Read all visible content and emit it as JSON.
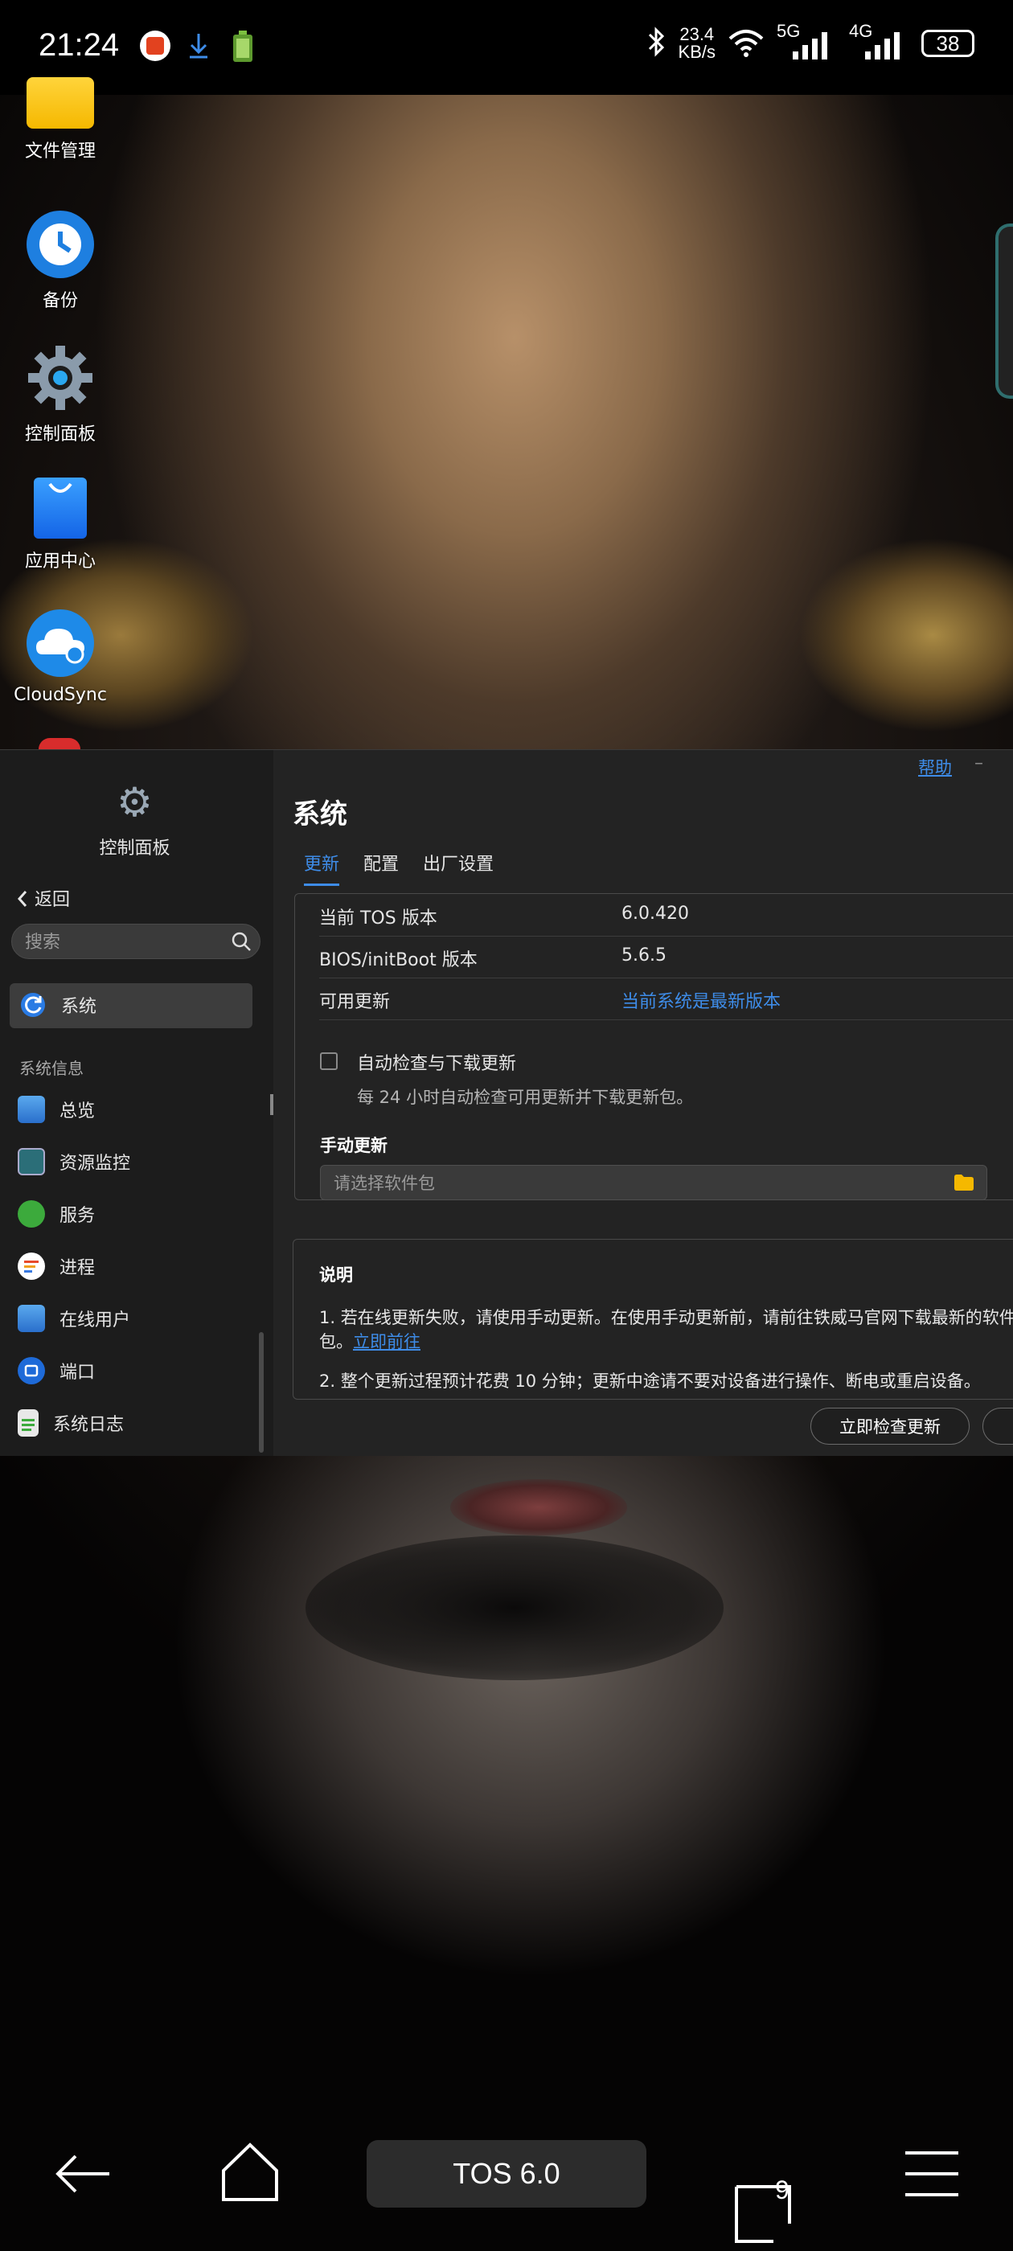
{
  "status_bar": {
    "time": "21:24",
    "net_speed_value": "23.4",
    "net_speed_unit": "KB/s",
    "net1": "5G",
    "net2": "4G",
    "battery": "38"
  },
  "desktop": {
    "icons": [
      {
        "label": "文件管理",
        "icon": "folder-icon"
      },
      {
        "label": "备份",
        "icon": "backup-clock-icon"
      },
      {
        "label": "控制面板",
        "icon": "gear-icon"
      },
      {
        "label": "应用中心",
        "icon": "shopping-bag-icon"
      },
      {
        "label": "CloudSync",
        "icon": "cloud-icon"
      }
    ]
  },
  "window": {
    "help": "帮助",
    "minimize": "–",
    "sidebar": {
      "app_title": "控制面板",
      "back": "返回",
      "search_placeholder": "搜索",
      "selected": "系统",
      "section_label": "系统信息",
      "items": [
        "总览",
        "资源监控",
        "服务",
        "进程",
        "在线用户",
        "端口",
        "系统日志"
      ]
    },
    "title": "系统",
    "tabs": [
      "更新",
      "配置",
      "出厂设置"
    ],
    "rows": [
      {
        "key": "当前 TOS 版本",
        "value": "6.0.420"
      },
      {
        "key": "BIOS/initBoot 版本",
        "value": "5.6.5"
      },
      {
        "key": "可用更新",
        "value": "当前系统是最新版本"
      }
    ],
    "auto_check_label": "自动检查与下载更新",
    "auto_check_desc": "每 24 小时自动检查可用更新并下载更新包。",
    "manual_title": "手动更新",
    "file_placeholder": "请选择软件包",
    "note_title": "说明",
    "note1": "1. 若在线更新失败，请使用手动更新。在使用手动更新前，请前往铁威马官网下载最新的软件包。",
    "note1_link": "立即前往",
    "note2": "2. 整个更新过程预计花费 10 分钟；更新中途请不要对设备进行操作、断电或重启设备。",
    "btn_check": "立即检查更新"
  },
  "navbar": {
    "center_label": "TOS 6.0",
    "recents_count": "9"
  },
  "colors": {
    "accent": "#3e8ce8",
    "window_bg": "#232323",
    "sidebar_bg": "#1c1c1c"
  }
}
